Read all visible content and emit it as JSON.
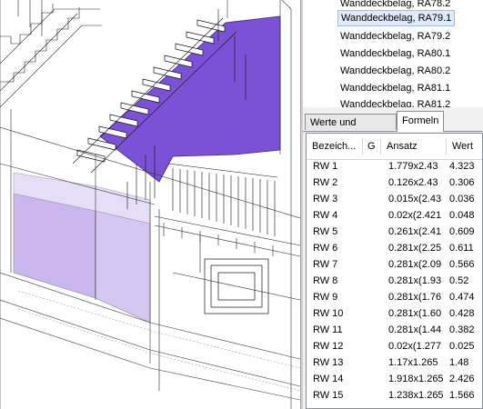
{
  "element_list": {
    "items": [
      {
        "label": "Wanddeckbelag, RA78.2",
        "selected": false
      },
      {
        "label": "Wanddeckbelag, RA79.1",
        "selected": true
      },
      {
        "label": "Wanddeckbelag, RA79.2",
        "selected": false
      },
      {
        "label": "Wanddeckbelag, RA80.1",
        "selected": false
      },
      {
        "label": "Wanddeckbelag, RA80.2",
        "selected": false
      },
      {
        "label": "Wanddeckbelag, RA81.1",
        "selected": false
      },
      {
        "label": "Wanddeckbelag, RA81.2",
        "selected": false
      }
    ]
  },
  "tabs": [
    {
      "label": "Werte und Attribute",
      "active": false
    },
    {
      "label": "Formeln",
      "active": true
    }
  ],
  "grid": {
    "headers": [
      "Bezeich...",
      "G",
      "Ansatz",
      "Wert"
    ],
    "rows": [
      {
        "name": "RW 1",
        "ansatz": "1.779x2.43",
        "wert": "4.323"
      },
      {
        "name": "RW 2",
        "ansatz": "0.126x2.43",
        "wert": "0.306"
      },
      {
        "name": "RW 3",
        "ansatz": "0.015x(2.43",
        "wert": "0.036"
      },
      {
        "name": "RW 4",
        "ansatz": "0.02x(2.421",
        "wert": "0.048"
      },
      {
        "name": "RW 5",
        "ansatz": "0.261x(2.41",
        "wert": "0.609"
      },
      {
        "name": "RW 6",
        "ansatz": "0.281x(2.25",
        "wert": "0.611"
      },
      {
        "name": "RW 7",
        "ansatz": "0.281x(2.09",
        "wert": "0.566"
      },
      {
        "name": "RW 8",
        "ansatz": "0.281x(1.93",
        "wert": "0.52"
      },
      {
        "name": "RW 9",
        "ansatz": "0.281x(1.76",
        "wert": "0.474"
      },
      {
        "name": "RW 10",
        "ansatz": "0.281x(1.60",
        "wert": "0.428"
      },
      {
        "name": "RW 11",
        "ansatz": "0.281x(1.44",
        "wert": "0.382"
      },
      {
        "name": "RW 12",
        "ansatz": "0.02x(1.277",
        "wert": "0.025"
      },
      {
        "name": "RW 13",
        "ansatz": "1.17x1.265",
        "wert": "1.48"
      },
      {
        "name": "RW 14",
        "ansatz": "1.918x1.265",
        "wert": "2.426"
      },
      {
        "name": "RW 15",
        "ansatz": "1.238x1.265",
        "wert": "1.566"
      }
    ]
  },
  "colors": {
    "highlight_face": "#7b52d6",
    "wall_face": "#c9b6ee",
    "selection": "#dfeaf8"
  }
}
